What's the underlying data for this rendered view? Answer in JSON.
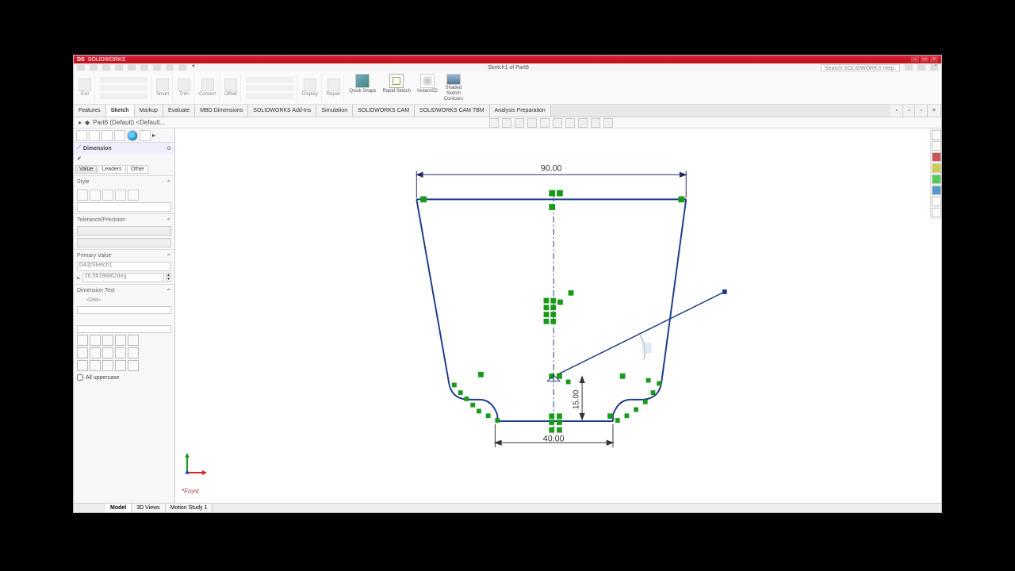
{
  "title": "SOLIDWORKS",
  "doc_title": "Sketch1 of Part6",
  "search_placeholder": "Search SOLIDWORKS Help",
  "ribbon_buttons": {
    "quick": "Quick Snaps",
    "rapid": "Rapid Sketch",
    "instant": "Instant2D",
    "shaded_l1": "Shaded",
    "shaded_l2": "Sketch",
    "shaded_l3": "Contours"
  },
  "tabs": [
    "Features",
    "Sketch",
    "Markup",
    "Evaluate",
    "MBD Dimensions",
    "SOLIDWORKS Add-Ins",
    "Simulation",
    "SOLIDWORKS CAM",
    "SOLIDWORKS CAM TBM",
    "Analysis Preparation"
  ],
  "active_tab": 1,
  "doc_tab": "Part6 (Default) <Default…",
  "feature_title": "Dimension",
  "side_tabs": [
    "Value",
    "Leaders",
    "Other"
  ],
  "sections": {
    "style": "Style",
    "tol": "Tolerance/Precision",
    "primary": "Primary Value",
    "primary_name": "D4@Sketch1",
    "primary_val": "26.56196862deg",
    "dimtext": "Dimension Text",
    "dimtext_token": "<DIM>",
    "alluc": "All uppercase"
  },
  "dimensions": {
    "top": "90.00",
    "bottom": "40.00",
    "height": "15.00"
  },
  "view": "*Front",
  "status_tabs": [
    "Model",
    "3D Views",
    "Motion Study 1"
  ]
}
